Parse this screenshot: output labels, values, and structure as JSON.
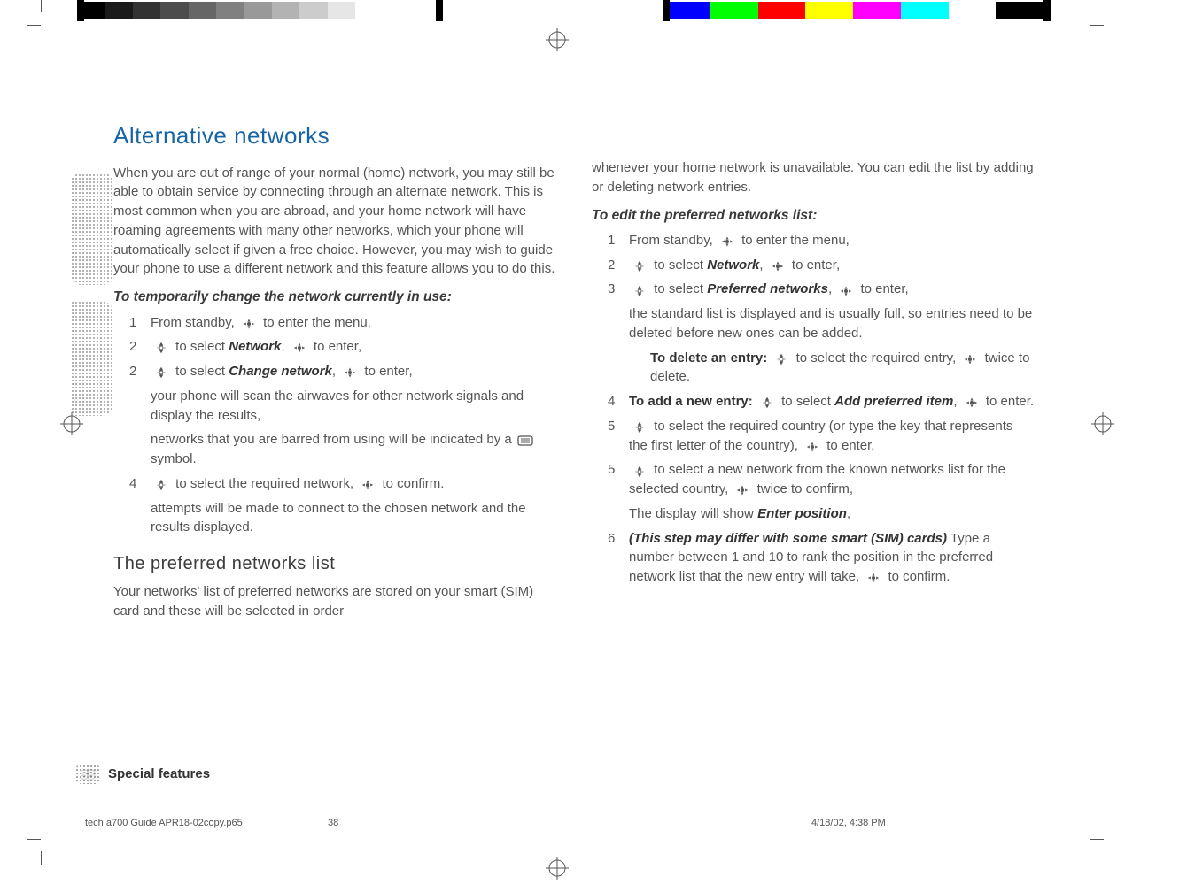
{
  "topbar_left": [
    "#000",
    "#1a1a1a",
    "#333",
    "#4d4d4d",
    "#666",
    "#808080",
    "#999",
    "#b3b3b3",
    "#ccc",
    "#e6e6e6",
    "#fff",
    "#fff",
    "#fff"
  ],
  "topbar_right": [
    "#0000ff",
    "#00ff00",
    "#ff0000",
    "#ffff00",
    "#ff00ff",
    "#00ffff",
    "#ffffff",
    "#000000"
  ],
  "section_title": "Alternative networks",
  "col1": {
    "intro": "When you are out of range of your normal (home) network, you may still be able to obtain service by connecting through an alternate network. This is most common when you are abroad, and your home network will have roaming agreements with many other networks, which your phone will automatically select if given a free choice. However, you may wish to guide your phone to use a different network and this feature allows you to do this.",
    "sub1": "To temporarily change the network currently in use:",
    "s1": {
      "n": "1",
      "a": "From standby, ",
      "b": " to enter the menu,"
    },
    "s2": {
      "n": "2",
      "a": " to select ",
      "kw": "Network",
      "b": ", ",
      "c": " to enter,"
    },
    "s3": {
      "n": "2",
      "a": " to select ",
      "kw": "Change network",
      "b": ", ",
      "c": " to enter,"
    },
    "note1": "your phone will scan the airwaves for other network signals and display the results,",
    "note2a": "networks that you are barred from using will be indicated by a ",
    "note2b": " symbol.",
    "s4": {
      "n": "4",
      "a": " to select the required network, ",
      "b": " to confirm."
    },
    "note3": "attempts will be made to connect to the chosen network and the results displayed.",
    "h2": "The preferred networks list",
    "p2": "Your networks' list of preferred networks are stored on your smart (SIM) card and these will be selected in order"
  },
  "col2": {
    "cont": "whenever your home network is unavailable. You can edit the list by adding or deleting network entries.",
    "sub2": "To edit the preferred networks list:",
    "e1": {
      "n": "1",
      "a": "From standby, ",
      "b": " to enter the menu,"
    },
    "e2": {
      "n": "2",
      "a": " to select ",
      "kw": "Network",
      "b": ", ",
      "c": " to enter,"
    },
    "e3": {
      "n": "3",
      "a": " to select ",
      "kw": "Preferred networks",
      "b": ", ",
      "c": " to enter,"
    },
    "enote1": "the standard list is displayed and is usually full, so entries need to be deleted before new ones can be added.",
    "del_label": "To delete an entry:",
    "del_a": " to select the required entry, ",
    "del_b": " twice to delete.",
    "e4": {
      "n": "4",
      "lead": "To add a new entry:",
      "a": " to select ",
      "kw": "Add preferred item",
      "b": ", ",
      "c": " to enter."
    },
    "e5": {
      "n": "5",
      "a": " to select the required country (or type the key that represents the first letter of the country), ",
      "b": " to enter,"
    },
    "e6": {
      "n": "5",
      "a": " to select a new network from the known networks list for the selected country, ",
      "b": " twice to confirm,"
    },
    "enote2a": "The display will show ",
    "enote2kw": "Enter position",
    "enote2b": ",",
    "e7": {
      "n": "6",
      "em": "(This step may differ with some smart (SIM) cards)",
      "a": " Type a number between 1 and 10 to rank the position in the preferred network list that the new entry will take, ",
      "b": " to confirm."
    }
  },
  "footer": {
    "pagenum": "38",
    "chapter": "Special features",
    "file": "tech a700 Guide APR18-02copy.p65",
    "pg": "38",
    "date": "4/18/02, 4:38 PM"
  }
}
